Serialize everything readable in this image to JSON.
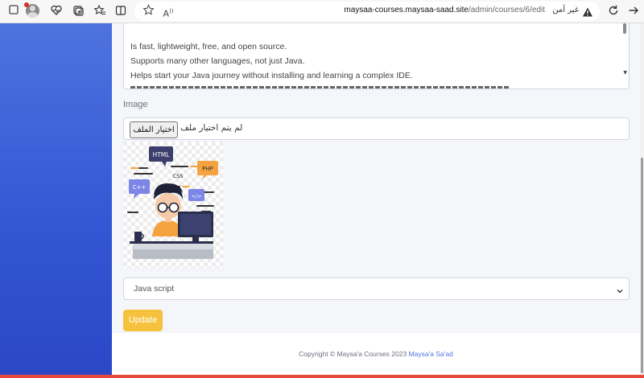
{
  "browser": {
    "url_host": "maysaa-courses.maysaa-saad.site",
    "url_path": "/admin/courses/6/edit",
    "insecure_label": "غير آمن",
    "icons": [
      "avatar",
      "heart-pulse-icon",
      "collections-icon",
      "favorites-icon",
      "split-screen-icon",
      "star-icon",
      "read-aloud-icon",
      "warning-icon",
      "refresh-icon",
      "forward-icon"
    ]
  },
  "form": {
    "description_lines": [
      "Is fast, lightweight, free, and open source.",
      "Supports many other languages, not just Java.",
      "Helps start your Java journey without installing and learning a complex IDE."
    ],
    "image_label": "Image",
    "file_button_label": "اختيار الملف",
    "file_status": "لم يتم اختيار ملف",
    "course_image": {
      "tags": [
        "HTML",
        "CSS",
        "PHP",
        "C++",
        "</>"
      ]
    },
    "category_selected": "Java script",
    "update_label": "Update"
  },
  "footer": {
    "copyright": "Copyright © Maysa'a Courses 2023",
    "author_link": "Maysa'a Sa'ad"
  },
  "colors": {
    "sidebar": "#4e73df",
    "button_warning": "#f6c23e",
    "link": "#4e73df",
    "accent_bottom": "#e74a3b"
  }
}
